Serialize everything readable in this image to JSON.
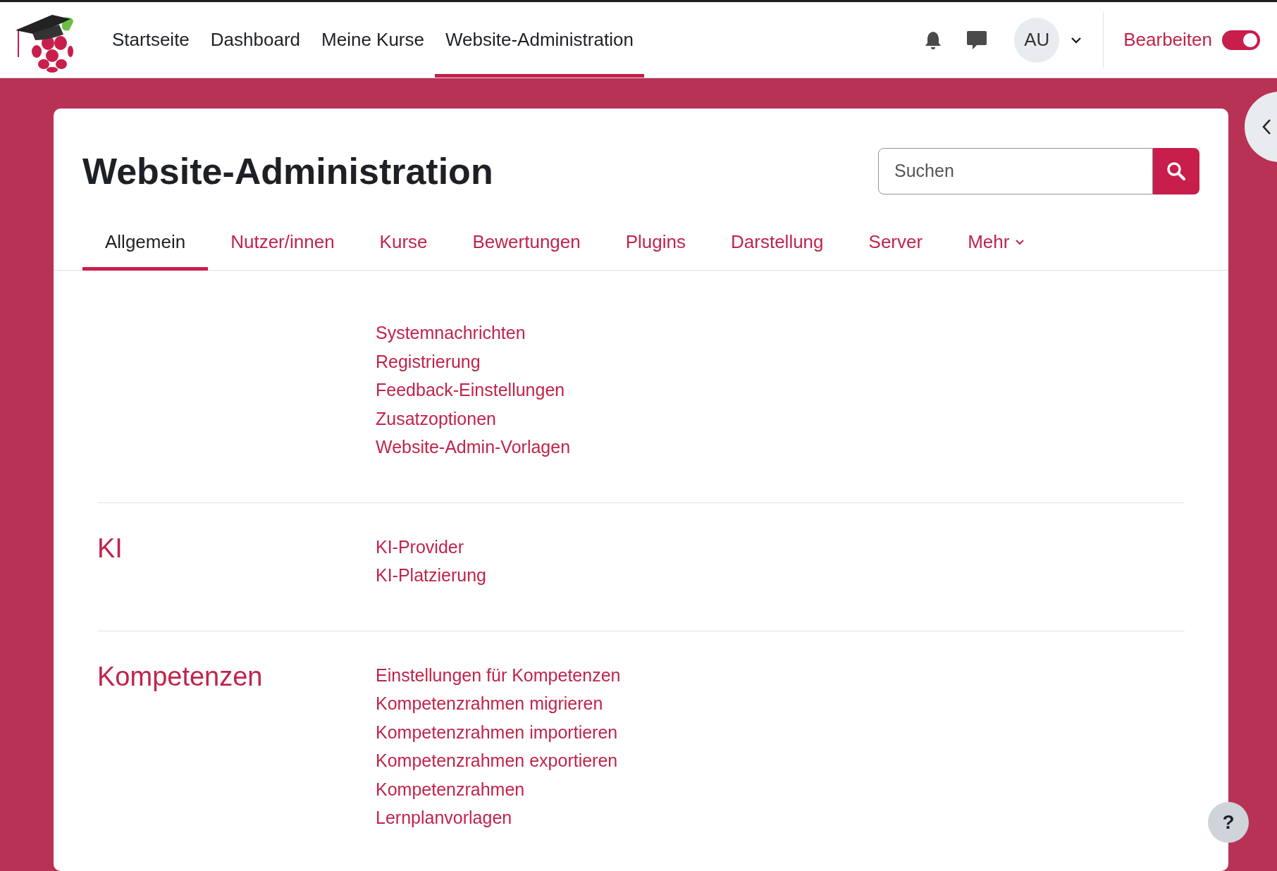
{
  "navbar": {
    "items": [
      {
        "label": "Startseite",
        "selected": false
      },
      {
        "label": "Dashboard",
        "selected": false
      },
      {
        "label": "Meine Kurse",
        "selected": false
      },
      {
        "label": "Website-Administration",
        "selected": true
      }
    ],
    "user_initials": "AU",
    "edit_mode": {
      "label": "Bearbeiten",
      "on": true
    }
  },
  "page": {
    "title": "Website-Administration",
    "search": {
      "placeholder": "Suchen"
    },
    "tabs": [
      {
        "label": "Allgemein",
        "selected": true,
        "dropdown": false
      },
      {
        "label": "Nutzer/innen",
        "selected": false,
        "dropdown": false
      },
      {
        "label": "Kurse",
        "selected": false,
        "dropdown": false
      },
      {
        "label": "Bewertungen",
        "selected": false,
        "dropdown": false
      },
      {
        "label": "Plugins",
        "selected": false,
        "dropdown": false
      },
      {
        "label": "Darstellung",
        "selected": false,
        "dropdown": false
      },
      {
        "label": "Server",
        "selected": false,
        "dropdown": false
      },
      {
        "label": "Mehr",
        "selected": false,
        "dropdown": true
      }
    ],
    "sections": [
      {
        "links": [
          "Systemnachrichten",
          "Registrierung",
          "Feedback-Einstellungen",
          "Zusatzoptionen",
          "Website-Admin-Vorlagen"
        ]
      },
      {
        "title": "KI",
        "links": [
          "KI-Provider",
          "KI-Platzierung"
        ]
      },
      {
        "title": "Kompetenzen",
        "links": [
          "Einstellungen für Kompetenzen",
          "Kompetenzrahmen migrieren",
          "Kompetenzrahmen importieren",
          "Kompetenzrahmen exportieren",
          "Kompetenzrahmen",
          "Lernplanvorlagen"
        ]
      }
    ]
  },
  "help_button": {
    "label": "?"
  }
}
